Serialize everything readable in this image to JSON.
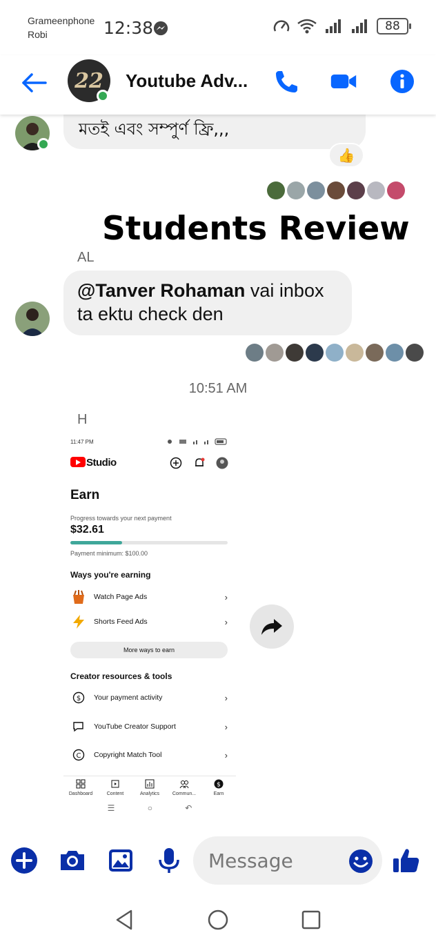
{
  "status_bar": {
    "carrier_1": "Grameenphone",
    "carrier_2": "Robi",
    "time": "12:38",
    "battery": "88"
  },
  "header": {
    "title": "Youtube Adv...",
    "avatar_text": "22",
    "icons": [
      "back-arrow-icon",
      "phone-icon",
      "video-call-icon",
      "info-icon"
    ],
    "accent_color": "#0866ff"
  },
  "messages": [
    {
      "text": "মতই এবং সম্পুর্ণ ফ্রি,,,",
      "reaction": "👍"
    },
    {
      "sender": "AL",
      "mention": "@Tanver Rohaman",
      "text": " vai inbox ta ektu check den"
    }
  ],
  "overlay_title": "Students Review",
  "timestamp": "10:51 AM",
  "shared_image": {
    "sender": "H",
    "status_time": "11:47 PM",
    "app_name": "Studio",
    "page_title": "Earn",
    "progress_label": "Progress towards your next payment",
    "amount": "$32.61",
    "progress_fraction": 0.33,
    "payment_minimum": "Payment minimum: $100.00",
    "ways_heading": "Ways you're earning",
    "ways": [
      {
        "label": "Watch Page Ads",
        "icon": "watch-page-ads-icon"
      },
      {
        "label": "Shorts Feed Ads",
        "icon": "lightning-icon"
      }
    ],
    "more_ways": "More ways to earn",
    "resources_heading": "Creator resources & tools",
    "resources": [
      {
        "label": "Your payment activity",
        "icon": "dollar-circle-icon"
      },
      {
        "label": "YouTube Creator Support",
        "icon": "chat-bubble-icon"
      },
      {
        "label": "Copyright Match Tool",
        "icon": "copyright-icon"
      }
    ],
    "bottom_nav": [
      "Dashboard",
      "Content",
      "Analytics",
      "Commun...",
      "Earn"
    ]
  },
  "composer": {
    "placeholder": "Message",
    "icons": [
      "plus-icon",
      "camera-icon",
      "gallery-icon",
      "mic-icon",
      "emoji-icon",
      "like-icon"
    ]
  }
}
